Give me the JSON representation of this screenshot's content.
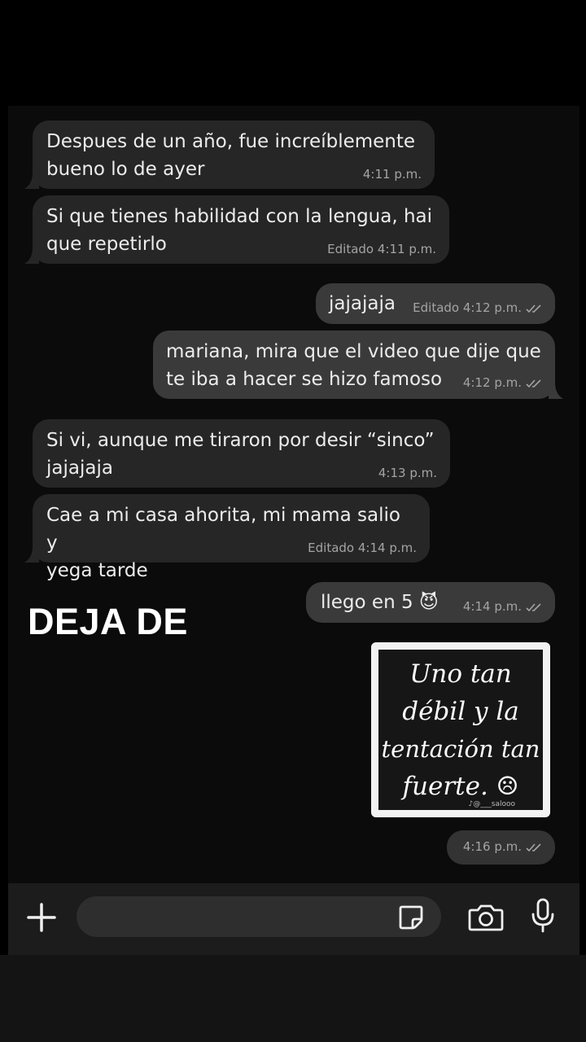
{
  "overlay": {
    "text": "DEJA DE"
  },
  "messages": [
    {
      "dir": "in",
      "lines": [
        "Despues de un año, fue increíblemente",
        "bueno lo de ayer"
      ],
      "time": "4:11 p.m."
    },
    {
      "dir": "in",
      "lines": [
        "Si que tienes habilidad con la lengua, hai",
        "que repetirlo"
      ],
      "time": "Editado 4:11 p.m."
    },
    {
      "dir": "out",
      "lines": [
        "jajajaja"
      ],
      "time": "Editado 4:12 p.m."
    },
    {
      "dir": "out",
      "lines": [
        "mariana, mira que el video que dije que",
        "te iba a hacer se hizo famoso"
      ],
      "time": "4:12 p.m."
    },
    {
      "dir": "in",
      "lines": [
        "Si vi, aunque me tiraron por desir “sinco”",
        "jajajaja"
      ],
      "time": "4:13 p.m."
    },
    {
      "dir": "in",
      "lines": [
        "Cae a mi casa ahorita, mi mama salio y",
        "yega tarde"
      ],
      "time": "Editado 4:14 p.m."
    },
    {
      "dir": "out",
      "lines": [
        "llego en 5 😈"
      ],
      "time": "4:14 p.m."
    }
  ],
  "sticker": {
    "lines": [
      "Uno tan",
      "débil y la",
      "tentación tan",
      "fuerte. ☹"
    ],
    "watermark": "♪@___salooo",
    "time": "4:16 p.m."
  },
  "input": {
    "placeholder": "",
    "icons": [
      "plus-icon",
      "sticker-icon",
      "camera-icon",
      "microphone-icon"
    ]
  },
  "colors": {
    "background": "#000000",
    "incoming": "#262626",
    "outgoing": "#3a3a3a"
  }
}
